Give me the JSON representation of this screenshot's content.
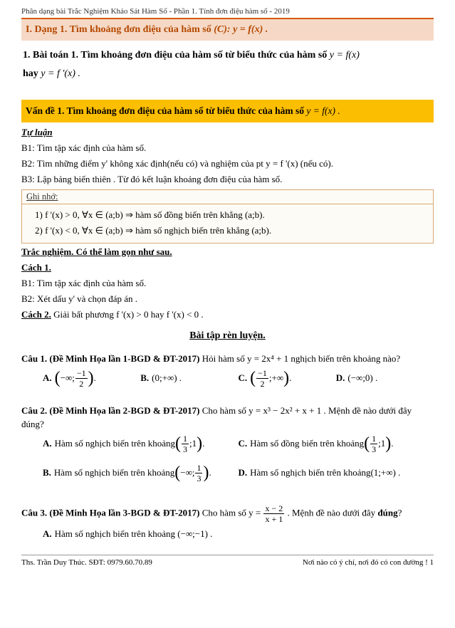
{
  "header": "Phân dạng bài Trắc Nghiệm Khảo Sát Hàm Số - Phần 1. Tính đơn điệu hàm số - 2019",
  "dang": {
    "label": "I. Dạng 1. Tìm khoảng đơn điệu của hàm số ",
    "formula": "(C): y = f(x) ."
  },
  "baitoan": {
    "label": "1. Bài toán 1. Tìm khoảng đơn điệu của hàm số từ biểu thức của hàm số ",
    "f1": "y = f(x)",
    "hay": "hay ",
    "f2": "y = f '(x) ."
  },
  "vande": {
    "label": "Vấn đề 1. Tìm khoảng đơn điệu của hàm số từ biểu thức của hàm số ",
    "formula": "y = f(x) ."
  },
  "tuluan": "Tự luận",
  "steps_tuluan": {
    "b1": "B1: Tìm tập xác định của hàm số.",
    "b2": "B2: Tìm những điểm y' không xác định(nếu có) và nghiệm của pt y = f '(x) (nếu có).",
    "b3": "B3: Lập bảng biến thiên . Từ đó kết luận khoảng đơn điệu của hàm số."
  },
  "ghinho": {
    "title": "Ghi nhớ:",
    "i1": "1)   f '(x) > 0, ∀x ∈ (a;b) ⇒  hàm số đồng biến trên khẳng (a;b).",
    "i2": "2)   f '(x) < 0, ∀x ∈ (a;b) ⇒  hàm số nghịch biến trên khẳng (a;b)."
  },
  "trac": "Trắc nghiệm. Có thể làm gọn như sau.",
  "cach1": "Cách 1.",
  "steps_cach1": {
    "b1": "B1: Tìm tập xác định của hàm số.",
    "b2": "B2: Xét dấu y' và chọn đáp án ."
  },
  "cach2": {
    "label": "Cách 2.",
    "text": " Giải bất phương f '(x) > 0  hay  f '(x) < 0 ."
  },
  "ex_heading": "Bài tập rèn luyện.",
  "q1": {
    "num": "Câu 1.",
    "source": "(Đề Minh Họa lần 1-BGD & ĐT-2017)",
    "text": " Hỏi hàm số  y = 2x⁴ + 1  nghịch biến trên khoảng nào?",
    "A_inner_l": "−∞;",
    "A_num": "−1",
    "A_den": "2",
    "B": "(0;+∞) .",
    "C_num": "−1",
    "C_den": "2",
    "C_inner_r": ";+∞",
    "D": "(−∞;0) ."
  },
  "q2": {
    "num": "Câu 2.",
    "source": "(Đề Minh Họa lần 2-BGD & ĐT-2017)",
    "text": " Cho hàm số  y = x³ − 2x² + x + 1 . Mệnh đề nào dưới đây đúng?",
    "A_pre": "Hàm số nghịch biến trên khoảng ",
    "A_num": "1",
    "A_den": "3",
    "A_right": ";1",
    "B_pre": "Hàm số nghịch biến trên khoảng ",
    "B_left": "−∞;",
    "B_num": "1",
    "B_den": "3",
    "C_pre": "Hàm số đồng biến trên khoảng ",
    "C_num": "1",
    "C_den": "3",
    "C_right": ";1",
    "D_pre": "Hàm số nghịch biến trên khoảng ",
    "D_interval": "(1;+∞) ."
  },
  "q3": {
    "num": "Câu 3.",
    "source": "(Đề Minh Họa lần 3-BGD & ĐT-2017)",
    "text_pre": " Cho hàm số  y = ",
    "frac_num": "x − 2",
    "frac_den": "x + 1",
    "text_post": " . Mệnh đề nào dưới đây ",
    "dung": "đúng",
    "tail": "?",
    "A": "Hàm số nghịch biến trên khoảng (−∞;−1) ."
  },
  "footer": {
    "left": "Ths. Trần Duy Thúc. SĐT: 0979.60.70.89",
    "right": "Nơi nào có ý chí, nơi đó có con đường !   1"
  },
  "letters": {
    "A": "A.",
    "B": "B.",
    "C": "C.",
    "D": "D."
  }
}
